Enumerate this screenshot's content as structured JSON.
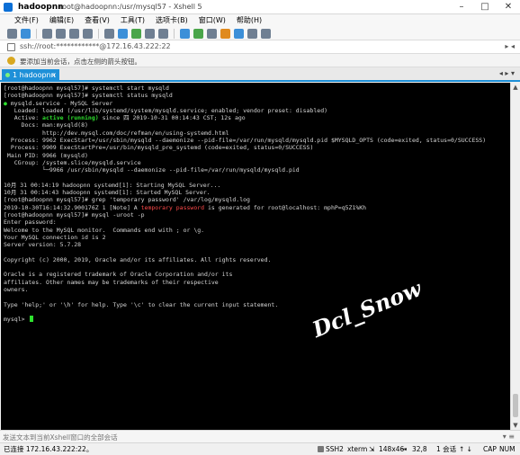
{
  "window": {
    "tab_title": "hadoopnn",
    "title": "root@hadoopnn:/usr/mysql57 - Xshell 5",
    "controls": [
      "–",
      "□",
      "✕"
    ]
  },
  "menu": [
    "文件(F)",
    "编辑(E)",
    "查看(V)",
    "工具(T)",
    "选项卡(B)",
    "窗口(W)",
    "帮助(H)"
  ],
  "address": {
    "text": "ssh://root:************@172.16.43.222:22",
    "nav": "▸ ◂"
  },
  "hint": {
    "text": "要添加当前会话，点击左侧的箭头按钮。"
  },
  "tab": {
    "label": "1 hadoopnn",
    "close": "×",
    "nav": "◂ ▸ ▾"
  },
  "terminal": {
    "lines": [
      "[root@hadoopnn mysql57]# systemctl start mysqld",
      "[root@hadoopnn mysql57]# systemctl status mysqld",
      "● mysqld.service - MySQL Server",
      "   Loaded: loaded (/usr/lib/systemd/system/mysqld.service; enabled; vendor preset: disabled)",
      "   Active: active (running) since 四 2019-10-31 00:14:43 CST; 12s ago",
      "     Docs: man:mysqld(8)",
      "           http://dev.mysql.com/doc/refman/en/using-systemd.html",
      "  Process: 9962 ExecStart=/usr/sbin/mysqld --daemonize --pid-file=/var/run/mysqld/mysqld.pid $MYSQLD_OPTS (code=exited, status=0/SUCCESS)",
      "  Process: 9909 ExecStartPre=/usr/bin/mysqld_pre_systemd (code=exited, status=0/SUCCESS)",
      " Main PID: 9966 (mysqld)",
      "   CGroup: /system.slice/mysqld.service",
      "           └─9966 /usr/sbin/mysqld --daemonize --pid-file=/var/run/mysqld/mysqld.pid",
      "",
      "10月 31 00:14:19 hadoopnn systemd[1]: Starting MySQL Server...",
      "10月 31 00:14:43 hadoopnn systemd[1]: Started MySQL Server.",
      "[root@hadoopnn mysql57]# grep 'temporary password' /var/log/mysqld.log",
      "2019-10-30T16:14:32.900176Z 1 [Note] A temporary password is generated for root@localhost: mphP=q5Z1%Kh",
      "[root@hadoopnn mysql57]# mysql -uroot -p",
      "Enter password:",
      "Welcome to the MySQL monitor.  Commands end with ; or \\g.",
      "Your MySQL connection id is 2",
      "Server version: 5.7.28",
      "",
      "Copyright (c) 2000, 2019, Oracle and/or its affiliates. All rights reserved.",
      "",
      "Oracle is a registered trademark of Oracle Corporation and/or its",
      "affiliates. Other names may be trademarks of their respective",
      "owners.",
      "",
      "Type 'help;' or '\\h' for help. Type '\\c' to clear the current input statement.",
      "",
      "mysql> "
    ],
    "green_line_prefix": "●",
    "active_state": "active (running)",
    "highlight_phrase": "temporary password",
    "watermark": "Dcl_Snow",
    "colors": {
      "background": "#000000",
      "text": "#d6d6d6",
      "active": "#2ee02e",
      "highlight": "#ff4a4a"
    }
  },
  "sendbar": {
    "placeholder": "发送文本到当前Xshell窗口的全部会话",
    "icons": "▾ ≡"
  },
  "status": {
    "connection": "已连接 172.16.43.222:22。",
    "protocol": "SSH2",
    "terminal_type": "xterm",
    "size": "148x46",
    "position": "32,8",
    "sessions": "1 会话",
    "arrows": "↑ ↓",
    "cap": "CAP",
    "num": "NUM"
  }
}
